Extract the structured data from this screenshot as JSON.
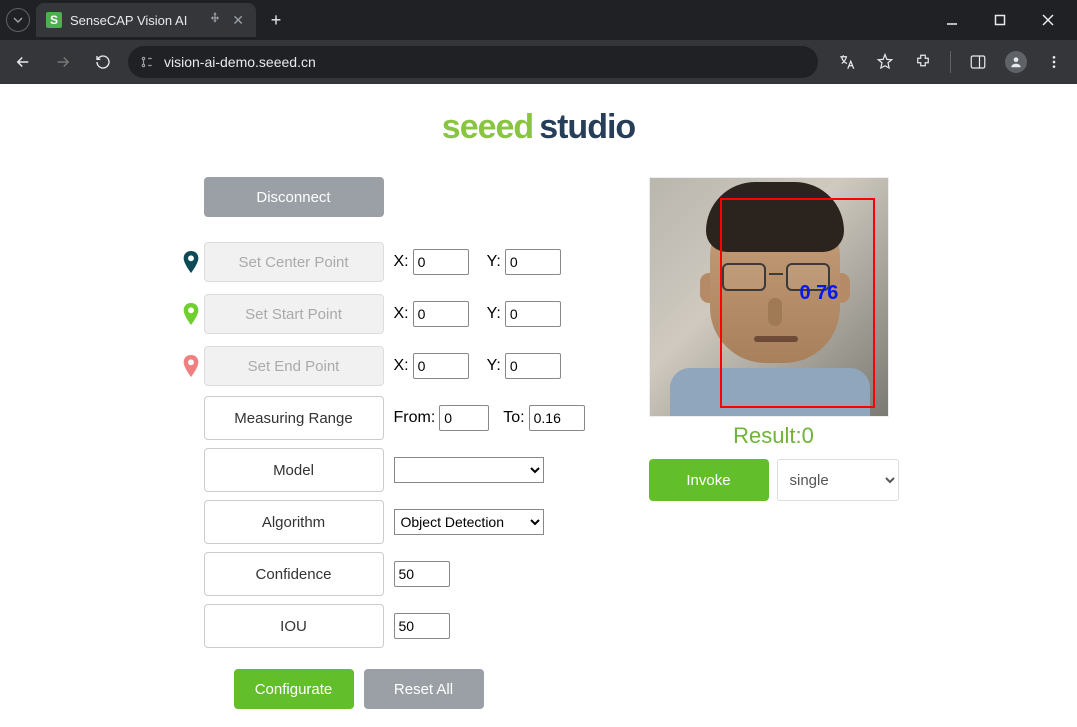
{
  "browser": {
    "tab_title": "SenseCAP Vision AI",
    "url": "vision-ai-demo.seeed.cn",
    "favicon_letter": "S"
  },
  "logo": {
    "part1": "seeed",
    "part2": "studio"
  },
  "controls": {
    "disconnect": "Disconnect",
    "set_center": "Set Center Point",
    "set_start": "Set Start Point",
    "set_end": "Set End Point",
    "measuring_range": "Measuring Range",
    "model": "Model",
    "algorithm": "Algorithm",
    "confidence": "Confidence",
    "iou": "IOU",
    "configurate": "Configurate",
    "reset_all": "Reset All",
    "x_label": "X:",
    "y_label": "Y:",
    "from_label": "From:",
    "to_label": "To:"
  },
  "values": {
    "center_x": "0",
    "center_y": "0",
    "start_x": "0",
    "start_y": "0",
    "end_x": "0",
    "end_y": "0",
    "range_from": "0",
    "range_to": "0.16",
    "model_selected": "",
    "algorithm_selected": "Object Detection",
    "confidence": "50",
    "iou": "50"
  },
  "detection": {
    "overlay_text": "0  76",
    "result_label": "Result:",
    "result_value": "0",
    "invoke": "Invoke",
    "mode_selected": "single"
  },
  "colors": {
    "pin_center": "#0c4a55",
    "pin_start": "#6fcf2f",
    "pin_end": "#f08080"
  }
}
